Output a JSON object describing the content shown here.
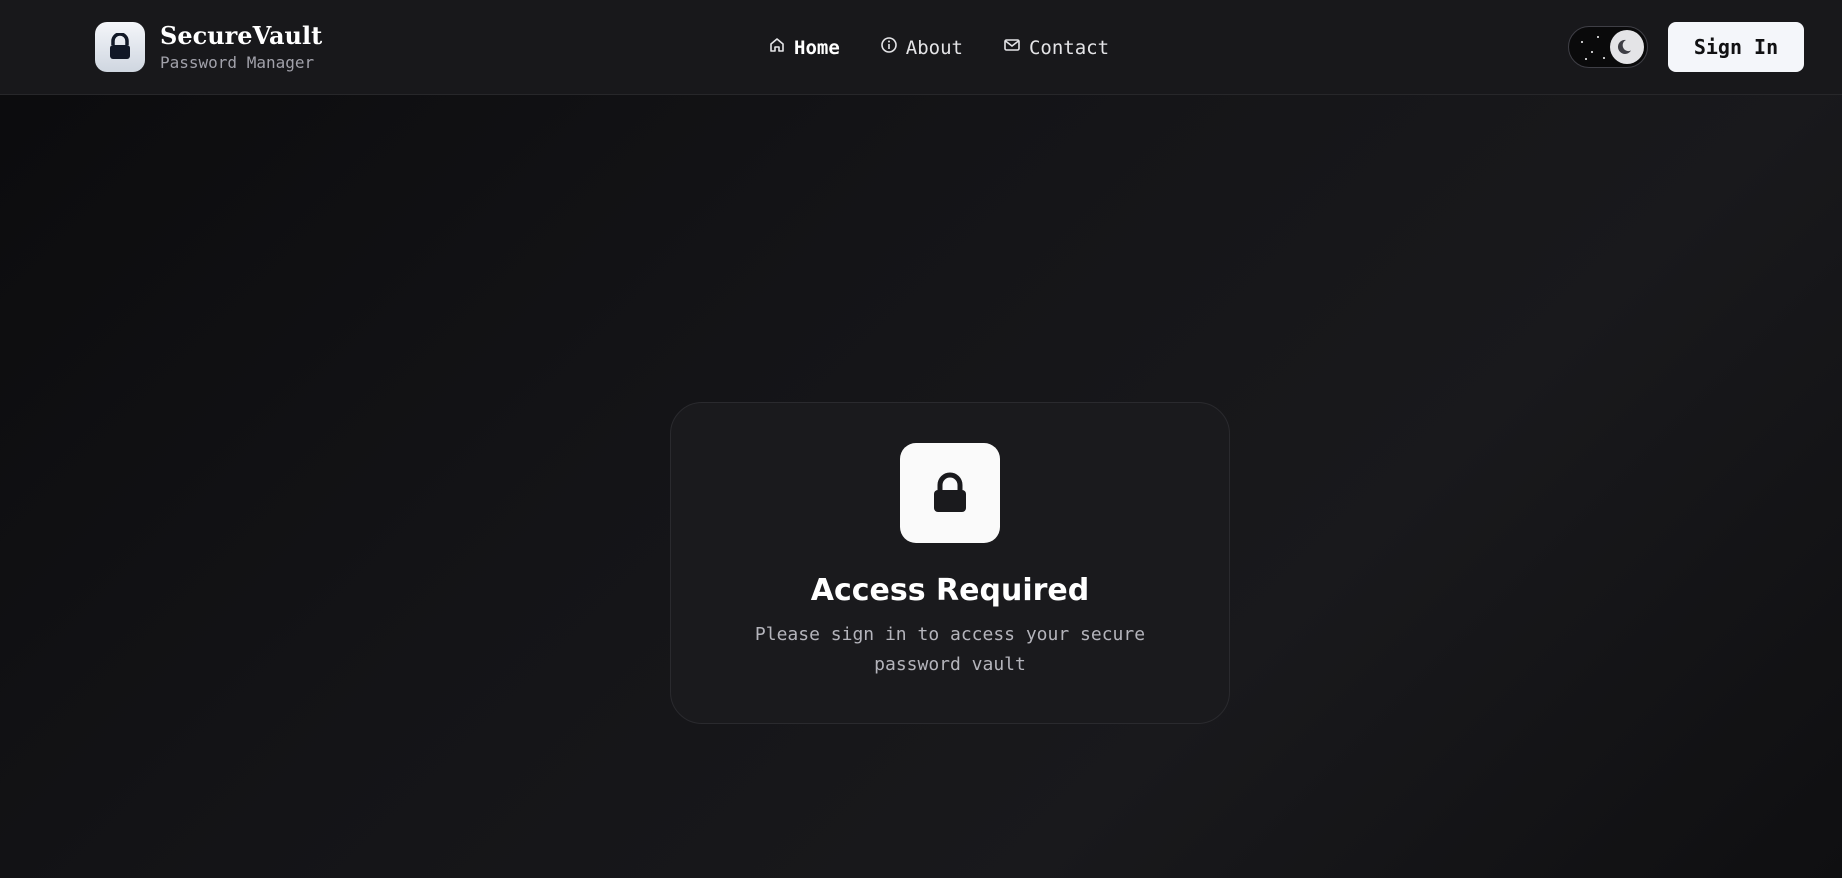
{
  "brand": {
    "title": "SecureVault",
    "subtitle": "Password Manager",
    "icon": "lock-icon"
  },
  "nav": {
    "items": [
      {
        "label": "Home",
        "icon": "home-icon",
        "active": true
      },
      {
        "label": "About",
        "icon": "info-icon",
        "active": false
      },
      {
        "label": "Contact",
        "icon": "mail-icon",
        "active": false
      }
    ]
  },
  "header": {
    "theme_toggle_icon": "moon-icon",
    "signin_label": "Sign In"
  },
  "card": {
    "icon": "lock-icon",
    "title": "Access Required",
    "text": "Please sign in to access your secure password vault"
  },
  "colors": {
    "background": "#0f0f11",
    "header_bg": "#18181b",
    "card_bg": "#1a1a1d",
    "accent_light": "#f4f6fa"
  }
}
